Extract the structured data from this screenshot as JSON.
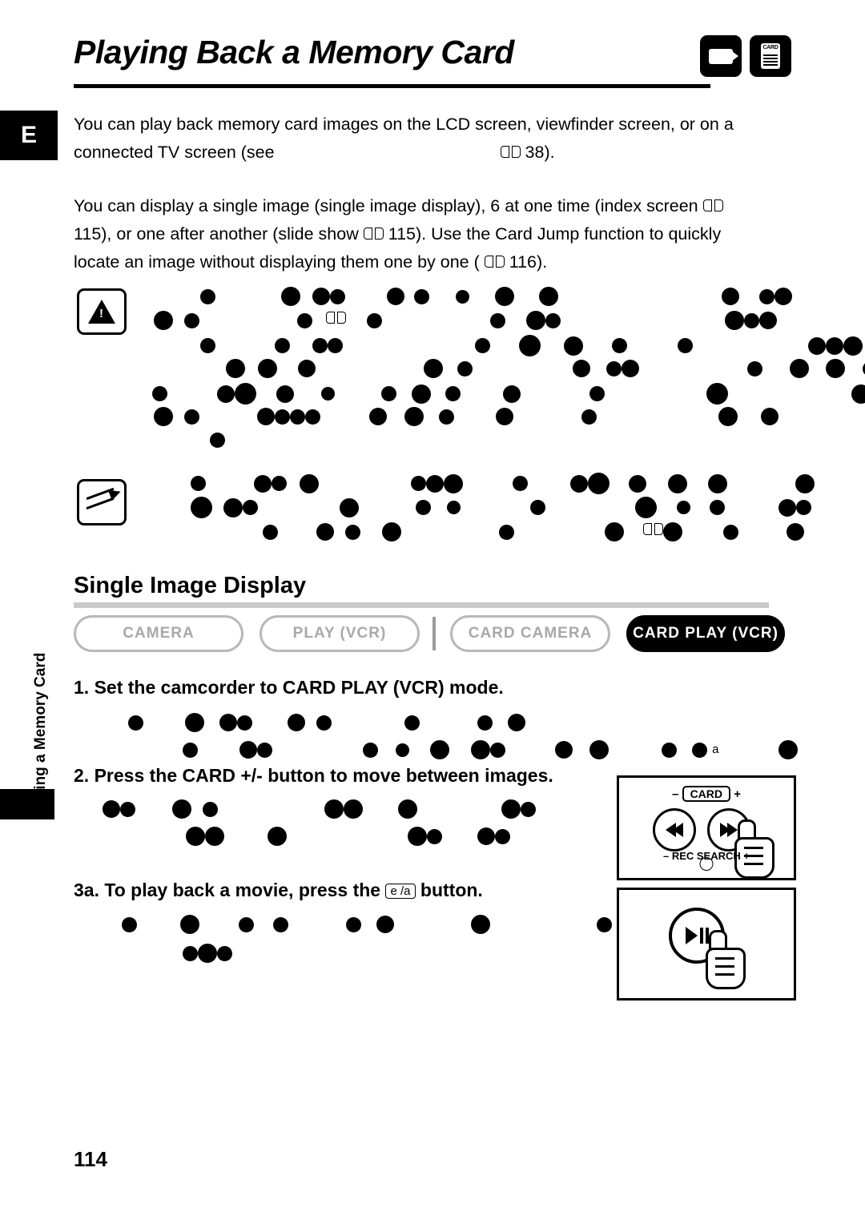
{
  "header": {
    "title": "Playing Back a Memory Card",
    "icons": [
      "card-camera-mode-icon",
      "card-play-vcr-mode-icon"
    ]
  },
  "language_tab": "E",
  "side_tab": {
    "label": "Using a Memory Card"
  },
  "intro": {
    "paragraph1_a": "You can play back memory card images on the LCD screen, viewfinder screen, or on a",
    "paragraph1_b": "connected TV screen (see",
    "paragraph1_ref": "38).",
    "paragraph2_a": "You can display a single image (single image display), 6 at one time (index screen",
    "paragraph2_b": "115), or one after another (slide show",
    "paragraph2_c": "115). Use the Card Jump function to quickly",
    "paragraph2_d": "locate an image without displaying them one by one (",
    "paragraph2_e": "116)."
  },
  "notes": {
    "warning_icon": "exclamation-note-icon",
    "memo_icon": "pencil-note-icon"
  },
  "section": {
    "heading": "Single Image Display"
  },
  "modes": [
    {
      "label": "CAMERA",
      "active": false
    },
    {
      "label": "PLAY (VCR)",
      "active": false
    },
    {
      "label": "CARD CAMERA",
      "active": false
    },
    {
      "label": "CARD PLAY (VCR)",
      "active": true
    }
  ],
  "steps": [
    {
      "number": "1.",
      "text": "Set the camcorder to CARD PLAY (VCR) mode."
    },
    {
      "number": "2.",
      "text": "Press the CARD +/- button to move between images."
    },
    {
      "number": "3a.",
      "text": "To play back a movie, press the",
      "button": "e /a",
      "text_b": "button."
    }
  ],
  "panel_card": {
    "minus": "–",
    "card_label": "CARD",
    "plus": "+",
    "rew_icon": "rewind-icon",
    "ff_icon": "fast-forward-icon",
    "rec_search_minus": "–",
    "rec_search_label": "REC SEARCH",
    "rec_search_plus": "+",
    "hand_icon": "hand-pointer-icon"
  },
  "panel_play": {
    "play_pause_icon": "play-pause-icon",
    "hand_icon": "hand-pointer-icon"
  },
  "footer": {
    "page_number": "114"
  },
  "colors": {
    "accent_black": "#000000",
    "mode_inactive": "#a8a8a8",
    "mode_border": "#b8b8b8",
    "rule_gray": "#c9c9c9"
  }
}
